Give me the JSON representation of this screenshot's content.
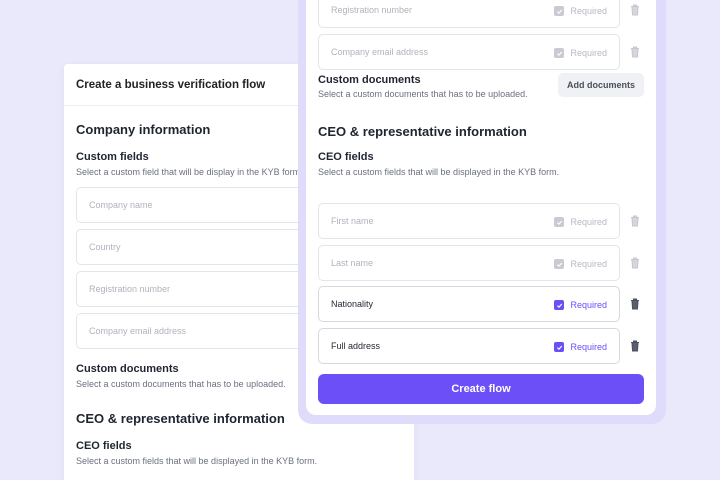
{
  "back": {
    "header_title": "Create a business verification flow",
    "company_section": "Company information",
    "custom_fields_title": "Custom fields",
    "custom_fields_hint": "Select a custom field that will be display in the KYB form.",
    "fields": [
      "Company name",
      "Country",
      "Registration number",
      "Company email address"
    ],
    "custom_docs_title": "Custom documents",
    "custom_docs_hint": "Select a custom documents that has to be uploaded.",
    "ceo_section": "CEO & representative information",
    "ceo_fields_title": "CEO fields",
    "ceo_fields_hint": "Select a custom fields that will be displayed in the KYB form."
  },
  "front": {
    "company_fields": [
      {
        "label": "Registration number",
        "required": "Required",
        "checked": false
      },
      {
        "label": "Company email address",
        "required": "Required",
        "checked": false
      }
    ],
    "custom_docs_title": "Custom documents",
    "custom_docs_hint": "Select a custom documents that has to be uploaded.",
    "add_documents_label": "Add documents",
    "ceo_section": "CEO & representative information",
    "ceo_fields_title": "CEO fields",
    "ceo_fields_hint": "Select a custom fields that will be displayed in the KYB form.",
    "ceo_fields": [
      {
        "label": "First name",
        "required": "Required",
        "checked": false
      },
      {
        "label": "Last name",
        "required": "Required",
        "checked": false
      },
      {
        "label": "Nationality",
        "required": "Required",
        "checked": true
      },
      {
        "label": "Full address",
        "required": "Required",
        "checked": true
      }
    ],
    "create_label": "Create flow"
  },
  "colors": {
    "accent": "#6c4ff6",
    "background": "#eae9fb",
    "frame": "#dedcfa"
  }
}
